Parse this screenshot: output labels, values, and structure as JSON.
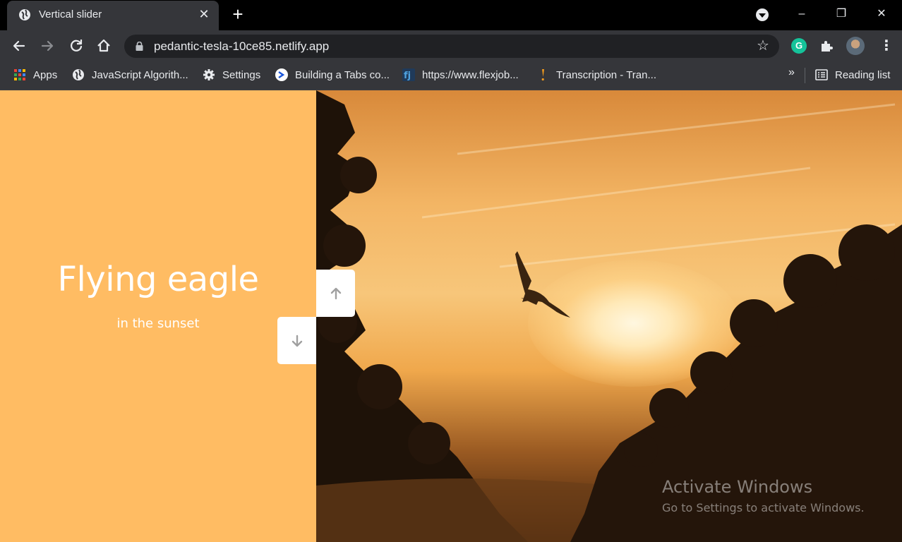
{
  "browser": {
    "tab_title": "Vertical slider",
    "url": "pedantic-tesla-10ce85.netlify.app",
    "window_controls": {
      "minimize": "–",
      "restore": "❐",
      "close": "✕"
    },
    "extensions": {
      "grammarly_label": "G"
    },
    "bookmarks": [
      {
        "label": "Apps",
        "icon": "apps-grid-icon"
      },
      {
        "label": "JavaScript Algorith...",
        "icon": "globe-icon"
      },
      {
        "label": "Settings",
        "icon": "gear-icon"
      },
      {
        "label": "Building a Tabs co...",
        "icon": "chevron-logo-icon"
      },
      {
        "label": "https://www.flexjob...",
        "icon": "flexjobs-icon"
      },
      {
        "label": "Transcription - Tran...",
        "icon": "exclamation-icon"
      }
    ],
    "bookmarks_more": "»",
    "reading_list": "Reading list"
  },
  "slide": {
    "title": "Flying eagle",
    "subtitle": "in the sunset",
    "left_color": "#ffbc63"
  },
  "controls": {
    "up_icon": "arrow-up-icon",
    "down_icon": "arrow-down-icon"
  },
  "watermark": {
    "title": "Activate Windows",
    "subtitle": "Go to Settings to activate Windows."
  }
}
